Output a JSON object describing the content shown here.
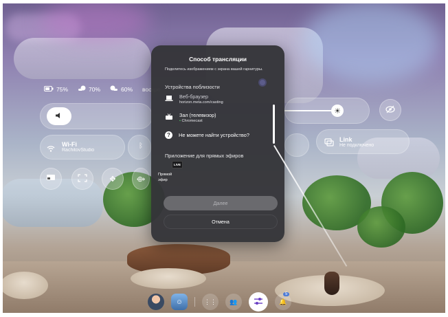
{
  "quick_settings": {
    "battery_headset": "75%",
    "battery_left_controller": "70%",
    "battery_right_controller": "60%",
    "day_truncated": "воскре",
    "wifi_title": "Wi-Fi",
    "wifi_network": "RachitovStudio",
    "link_title": "Link",
    "link_status": "Не подключено"
  },
  "dialog": {
    "title": "Способ трансляции",
    "subtitle": "Поделитесь изображением с экрана вашей гарнитуры.",
    "nearby_section": "Устройства поблизости",
    "devices": [
      {
        "name": "Веб-браузер",
        "sub": "horizon.meta.com/casting",
        "icon": "laptop-icon"
      },
      {
        "name": "Зал (телевизор)",
        "sub": "Chromecast",
        "icon": "tv-icon"
      }
    ],
    "help_text": "Не можете найти устройство?",
    "live_section": "Приложение для прямых эфиров",
    "live_badge": "LIVE",
    "live_app_label": "Прямой эфир",
    "next_button": "Далее",
    "cancel_button": "Отмена"
  },
  "taskbar": {
    "notification_count": "5"
  },
  "colors": {
    "dialog_bg": "#343438",
    "connected_dot": "#56d36d",
    "active_app_accent": "#6a3fc4"
  }
}
